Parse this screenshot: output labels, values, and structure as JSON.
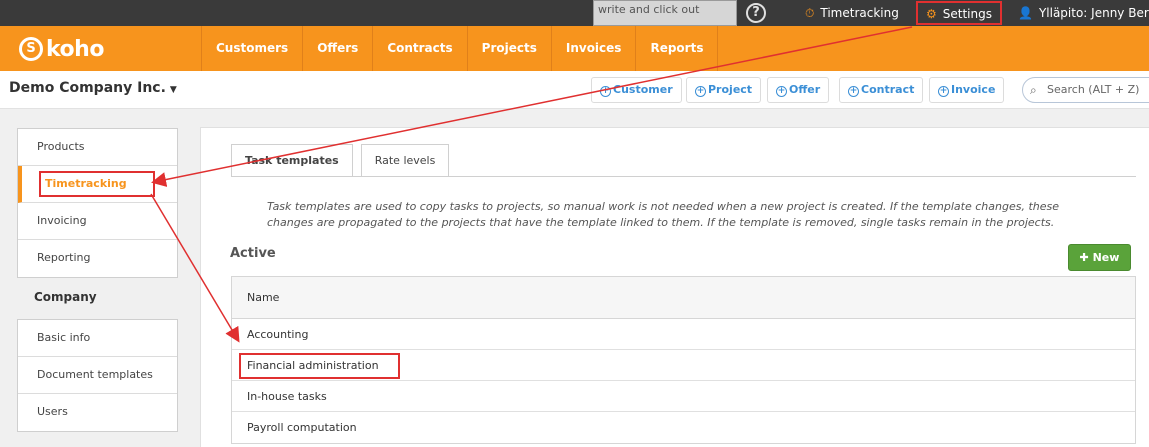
{
  "topbar": {
    "quick_input_value": "write and click out",
    "help_icon": "?",
    "timetracking_label": "Timetracking",
    "settings_label": "Settings",
    "user_label": "Ylläpito: Jenny Berg"
  },
  "brand": {
    "logo_text": "koho",
    "accent_color": "#f7941d"
  },
  "nav": {
    "items": [
      "Customers",
      "Offers",
      "Contracts",
      "Projects",
      "Invoices",
      "Reports"
    ]
  },
  "company_bar": {
    "company_name": "Demo Company Inc.",
    "quick_actions": [
      "Customer",
      "Project",
      "Offer",
      "Contract",
      "Invoice"
    ],
    "search_placeholder": "Search (ALT + Z)"
  },
  "sidebar": {
    "group1": [
      "Products",
      "Timetracking",
      "Invoicing",
      "Reporting"
    ],
    "active_item": "Timetracking",
    "company_heading": "Company",
    "group2": [
      "Basic info",
      "Document templates",
      "Users"
    ]
  },
  "main": {
    "tabs": [
      "Task templates",
      "Rate levels"
    ],
    "active_tab": "Task templates",
    "description": "Task templates are used to copy tasks to projects, so manual work is not needed when a new project is created. If the template changes, these changes are propagated to the projects that have the template linked to them. If the template is removed, single tasks remain in the projects.",
    "section_heading": "Active",
    "new_button": "New",
    "table": {
      "header": "Name",
      "rows": [
        "Accounting",
        "Financial administration",
        "In-house tasks",
        "Payroll computation"
      ]
    }
  },
  "colors": {
    "annotation_red": "#e03030",
    "new_button_green": "#5aa33a",
    "link_blue": "#3b8fd6"
  }
}
